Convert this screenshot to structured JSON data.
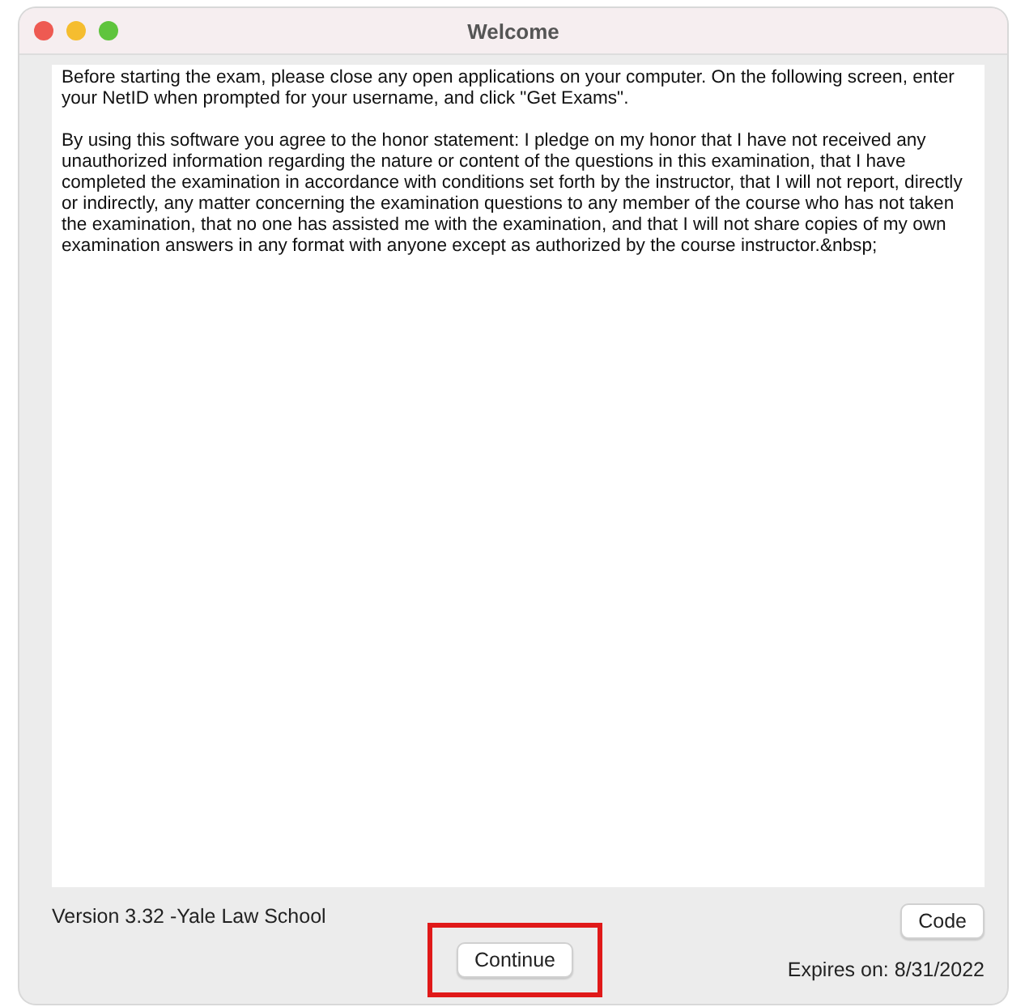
{
  "window": {
    "title": "Welcome"
  },
  "message": {
    "paragraphs": [
      "Before starting the exam, please close any open applications on your computer. On the following screen, enter your NetID when prompted for your username, and click \"Get Exams\".",
      "By using this software you agree to the honor statement: I pledge on my honor that I have not received any unauthorized information regarding the nature or content of the questions in this examination, that I have completed the examination in accordance with conditions set forth by the instructor, that I will not report, directly or indirectly, any matter concerning the examination questions to any member of the course who has not taken the examination, that no one has assisted me with the examination, and that I will not share copies of my own examination answers in any format with anyone except as authorized by the course instructor.&nbsp;"
    ]
  },
  "footer": {
    "version": "Version 3.32 -Yale Law School",
    "code_button": "Code",
    "continue_button": {
      "label": "Continue",
      "highlighted": true
    },
    "expires": "Expires on: 8/31/2022"
  }
}
